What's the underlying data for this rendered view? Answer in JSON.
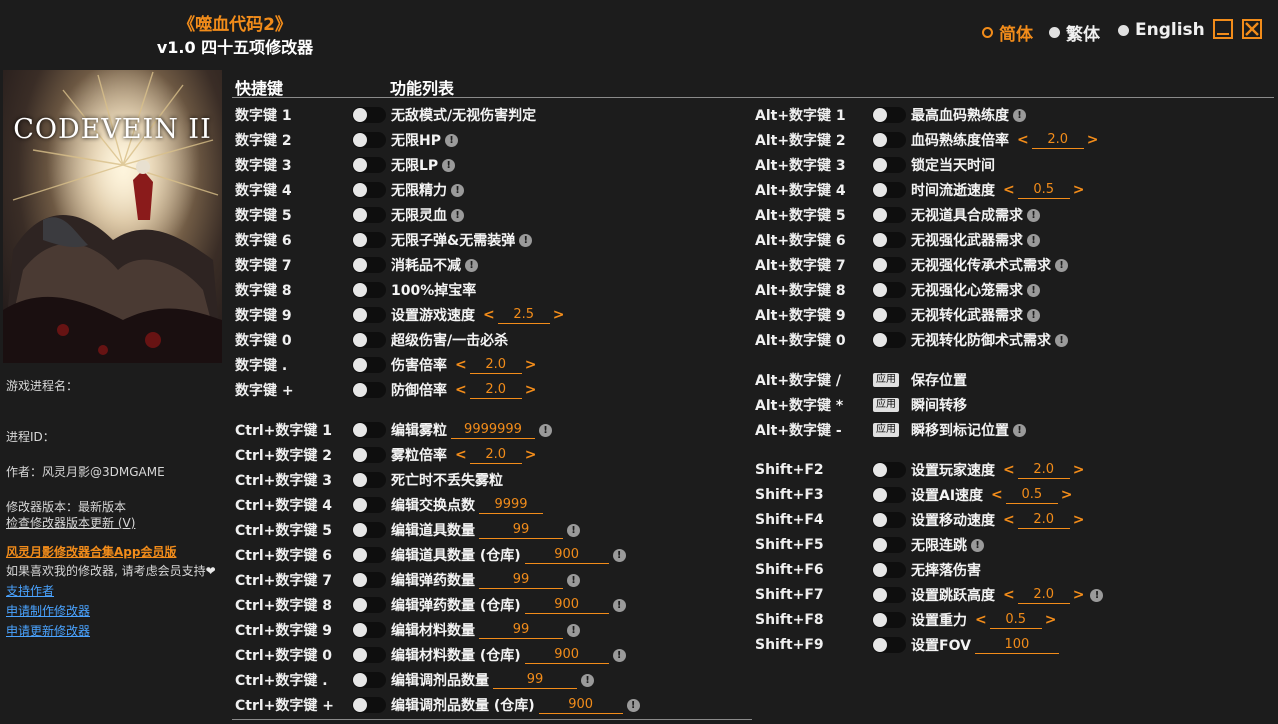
{
  "header": {
    "title": "《噬血代码2》",
    "subtitle": "v1.0 四十五项修改器"
  },
  "languages": [
    {
      "label": "简体",
      "active": true
    },
    {
      "label": "繁体",
      "active": false
    },
    {
      "label": "English",
      "active": false
    }
  ],
  "cover": {
    "logo_text": "CODEVEIN II"
  },
  "sidebar": {
    "process_name_label": "游戏进程名：",
    "process_id_label": "进程ID：",
    "author": "作者：风灵月影@3DMGAME",
    "version": "修改器版本：最新版本",
    "check_update": "检查修改器版本更新 (V)",
    "app_promo": "风灵月影修改器合集App会员版",
    "support_text": "如果喜欢我的修改器, 请考虑会员支持",
    "support_author": "支持作者",
    "request_new": "申请制作修改器",
    "request_update": "申请更新修改器"
  },
  "table_headers": {
    "hotkey": "快捷键",
    "features": "功能列表"
  },
  "left_column": [
    {
      "key": "数字键 1",
      "label": "无敌模式/无视伤害判定"
    },
    {
      "key": "数字键 2",
      "label": "无限HP",
      "info": true
    },
    {
      "key": "数字键 3",
      "label": "无限LP",
      "info": true
    },
    {
      "key": "数字键 4",
      "label": "无限精力",
      "info": true
    },
    {
      "key": "数字键 5",
      "label": "无限灵血",
      "info": true
    },
    {
      "key": "数字键 6",
      "label": "无限子弹&无需装弹",
      "info": true
    },
    {
      "key": "数字键 7",
      "label": "消耗品不减",
      "info": true
    },
    {
      "key": "数字键 8",
      "label": "100%掉宝率"
    },
    {
      "key": "数字键 9",
      "label": "设置游戏速度",
      "stepper": "2.5"
    },
    {
      "key": "数字键 0",
      "label": "超级伤害/一击必杀"
    },
    {
      "key": "数字键 .",
      "label": "伤害倍率",
      "stepper": "2.0"
    },
    {
      "key": "数字键 +",
      "label": "防御倍率",
      "stepper": "2.0"
    },
    {
      "key": "Ctrl+数字键 1",
      "label": "编辑雾粒",
      "field": "9999999",
      "info": true
    },
    {
      "key": "Ctrl+数字键 2",
      "label": "雾粒倍率",
      "stepper": "2.0"
    },
    {
      "key": "Ctrl+数字键 3",
      "label": "死亡时不丢失雾粒"
    },
    {
      "key": "Ctrl+数字键 4",
      "label": "编辑交换点数",
      "field": "9999"
    },
    {
      "key": "Ctrl+数字键 5",
      "label": "编辑道具数量",
      "field": "99",
      "info": true
    },
    {
      "key": "Ctrl+数字键 6",
      "label": "编辑道具数量 (仓库)",
      "field": "900",
      "info": true
    },
    {
      "key": "Ctrl+数字键 7",
      "label": "编辑弹药数量",
      "field": "99",
      "info": true
    },
    {
      "key": "Ctrl+数字键 8",
      "label": "编辑弹药数量 (仓库)",
      "field": "900",
      "info": true
    },
    {
      "key": "Ctrl+数字键 9",
      "label": "编辑材料数量",
      "field": "99",
      "info": true
    },
    {
      "key": "Ctrl+数字键 0",
      "label": "编辑材料数量 (仓库)",
      "field": "900",
      "info": true
    },
    {
      "key": "Ctrl+数字键 .",
      "label": "编辑调剂品数量",
      "field": "99",
      "info": true
    },
    {
      "key": "Ctrl+数字键 +",
      "label": "编辑调剂品数量 (仓库)",
      "field": "900",
      "info": true
    }
  ],
  "right_column": [
    {
      "key": "Alt+数字键 1",
      "label": "最高血码熟练度",
      "info": true
    },
    {
      "key": "Alt+数字键 2",
      "label": "血码熟练度倍率",
      "stepper": "2.0"
    },
    {
      "key": "Alt+数字键 3",
      "label": "锁定当天时间"
    },
    {
      "key": "Alt+数字键 4",
      "label": "时间流逝速度",
      "stepper": "0.5"
    },
    {
      "key": "Alt+数字键 5",
      "label": "无视道具合成需求",
      "info": true
    },
    {
      "key": "Alt+数字键 6",
      "label": "无视强化武器需求",
      "info": true
    },
    {
      "key": "Alt+数字键 7",
      "label": "无视强化传承术式需求",
      "info": true
    },
    {
      "key": "Alt+数字键 8",
      "label": "无视强化心笼需求",
      "info": true
    },
    {
      "key": "Alt+数字键 9",
      "label": "无视转化武器需求",
      "info": true
    },
    {
      "key": "Alt+数字键 0",
      "label": "无视转化防御术式需求",
      "info": true
    },
    {
      "key": "Alt+数字键 /",
      "label": "保存位置",
      "apply": "应用"
    },
    {
      "key": "Alt+数字键 *",
      "label": "瞬间转移",
      "apply": "应用"
    },
    {
      "key": "Alt+数字键 -",
      "label": "瞬移到标记位置",
      "apply": "应用",
      "info": true
    },
    {
      "key": "Shift+F2",
      "label": "设置玩家速度",
      "stepper": "2.0"
    },
    {
      "key": "Shift+F3",
      "label": "设置AI速度",
      "stepper": "0.5"
    },
    {
      "key": "Shift+F4",
      "label": "设置移动速度",
      "stepper": "2.0"
    },
    {
      "key": "Shift+F5",
      "label": "无限连跳",
      "info": true
    },
    {
      "key": "Shift+F6",
      "label": "无摔落伤害"
    },
    {
      "key": "Shift+F7",
      "label": "设置跳跃高度",
      "stepper": "2.0",
      "info": true
    },
    {
      "key": "Shift+F8",
      "label": "设置重力",
      "stepper": "0.5"
    },
    {
      "key": "Shift+F9",
      "label": "设置FOV",
      "field": "100"
    }
  ],
  "colors": {
    "accent": "#f28c1a",
    "background": "#1c1c1c",
    "link": "#4aa3ff"
  }
}
